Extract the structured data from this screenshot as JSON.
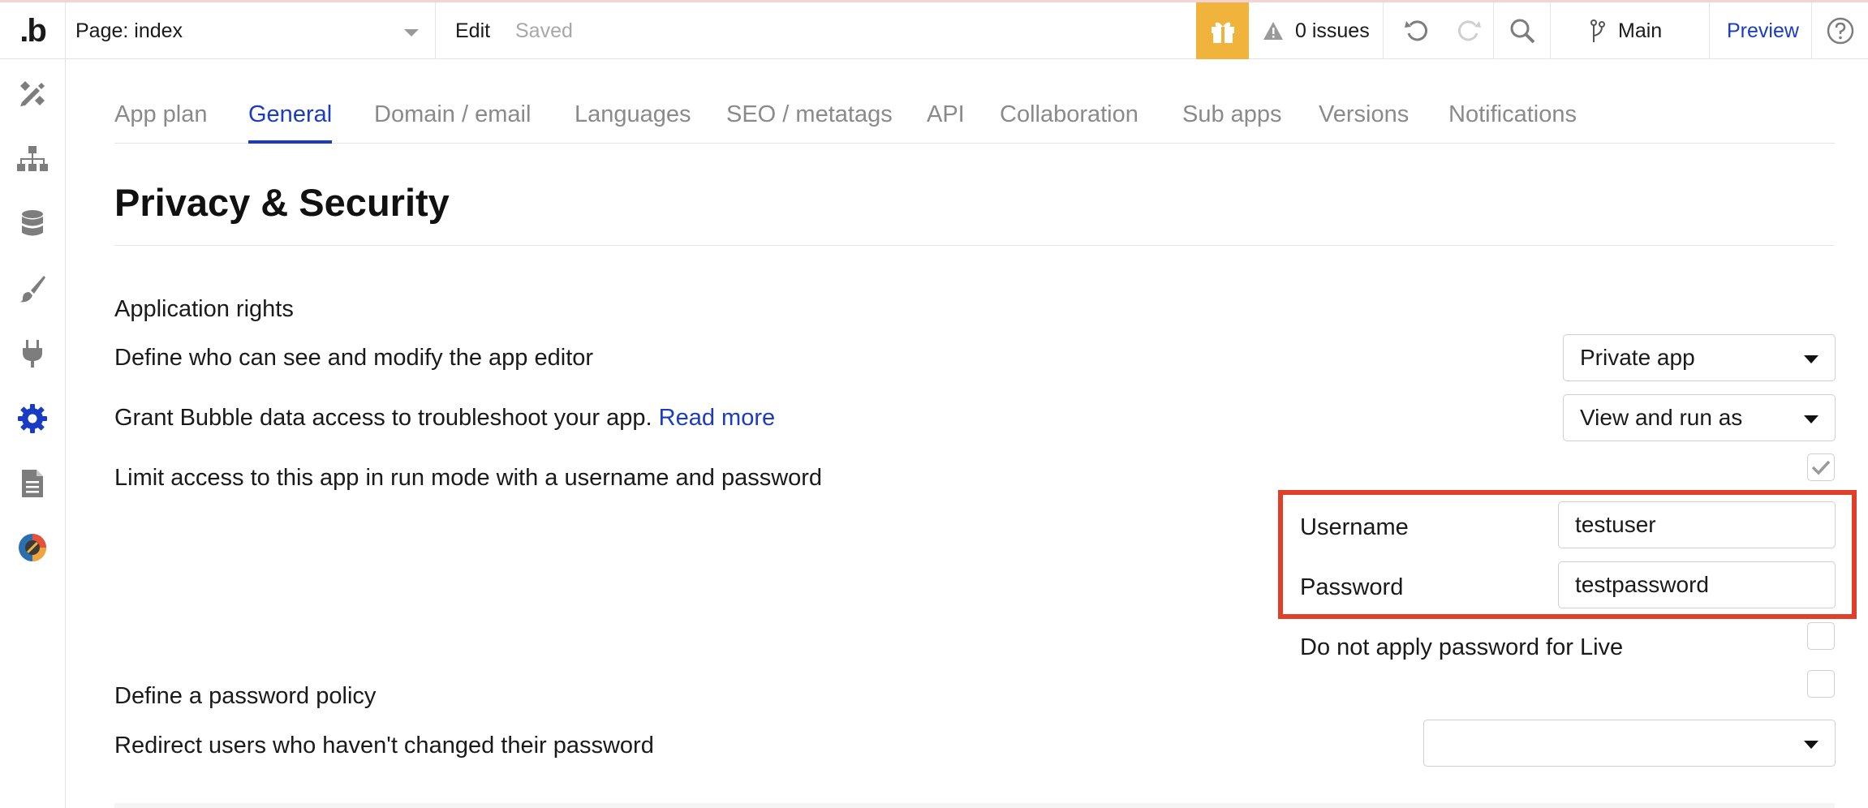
{
  "topbar": {
    "logo": ".b",
    "page_select": "Page: index",
    "edit_label": "Edit",
    "saved_label": "Saved",
    "issues_label": "0 issues",
    "branch_label": "Main",
    "preview_label": "Preview"
  },
  "tabs": [
    {
      "label": "App plan"
    },
    {
      "label": "General"
    },
    {
      "label": "Domain / email"
    },
    {
      "label": "Languages"
    },
    {
      "label": "SEO / metatags"
    },
    {
      "label": "API"
    },
    {
      "label": "Collaboration"
    },
    {
      "label": "Sub apps"
    },
    {
      "label": "Versions"
    },
    {
      "label": "Notifications"
    }
  ],
  "active_tab": "General",
  "main": {
    "title": "Privacy & Security",
    "application_rights": "Application rights",
    "define_who": "Define who can see and modify the app editor",
    "editor_access_value": "Private app",
    "grant_bubble": "Grant Bubble data access to troubleshoot your app.",
    "read_more": "Read more",
    "data_access_value": "View and run as",
    "limit_access": "Limit access to this app in run mode with a username and password",
    "limit_access_checked": true,
    "username_label": "Username",
    "username_value": "testuser",
    "password_label": "Password",
    "password_value": "testpassword",
    "no_password_live": "Do not apply password for Live",
    "no_password_live_checked": false,
    "password_policy": "Define a password policy",
    "password_policy_checked": false,
    "redirect_users": "Redirect users who haven't changed their password",
    "redirect_value": ""
  },
  "colors": {
    "accent": "#1a3cc4",
    "gift": "#f0b43c",
    "highlight": "#e0402a"
  },
  "icons": {
    "sidebar": [
      "design-icon",
      "workflow-icon",
      "data-icon",
      "styles-icon",
      "plugins-icon",
      "settings-icon",
      "logs-icon",
      "app-icon"
    ]
  }
}
